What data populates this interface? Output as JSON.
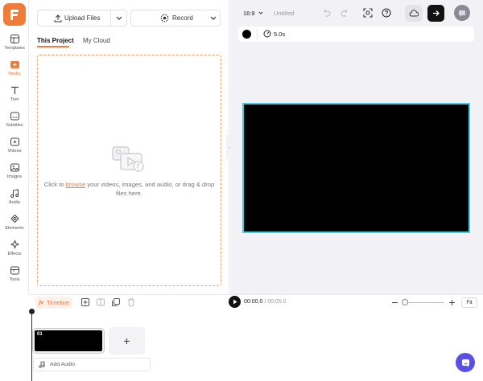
{
  "brand": {
    "color": "#f07c3a"
  },
  "rail": {
    "items": [
      {
        "label": "Templates",
        "icon": "templates-icon"
      },
      {
        "label": "Media",
        "icon": "media-icon",
        "active": true
      },
      {
        "label": "Text",
        "icon": "text-icon"
      },
      {
        "label": "Subtitles",
        "icon": "subtitles-icon"
      },
      {
        "label": "Videos",
        "icon": "videos-icon"
      },
      {
        "label": "Images",
        "icon": "images-icon"
      },
      {
        "label": "Audio",
        "icon": "audio-icon"
      },
      {
        "label": "Elements",
        "icon": "elements-icon"
      },
      {
        "label": "Effects",
        "icon": "effects-icon"
      },
      {
        "label": "Tools",
        "icon": "tools-icon"
      }
    ]
  },
  "panel": {
    "upload_label": "Upload Files",
    "record_label": "Record",
    "tabs": [
      "This Project",
      "My Cloud"
    ],
    "drop": {
      "prefix": "Click to ",
      "link": "browse",
      "suffix": " your videos, images, and audio, or drag & drop files here."
    }
  },
  "topbar": {
    "aspect": "16:9",
    "title": "Untitled"
  },
  "preview": {
    "background_color": "#000000",
    "duration": "5.0s",
    "canvas_border": "#3ad1e8"
  },
  "timeline": {
    "tab_label": "Timeline",
    "current_time": "00:00.0",
    "total_time": "/ 00:05.0",
    "fit_label": "Fit",
    "clip_number": "01",
    "add_clip": "+",
    "add_audio": "Add Audio"
  }
}
